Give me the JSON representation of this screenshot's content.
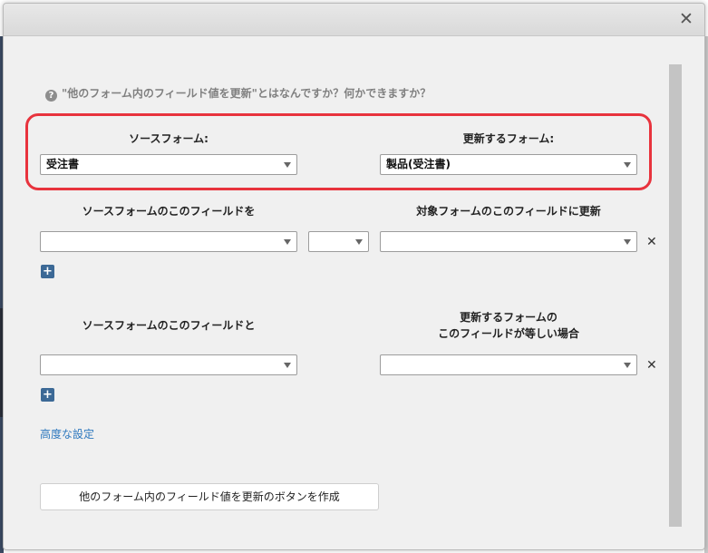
{
  "dialog": {
    "close_icon": "close-icon"
  },
  "help": {
    "icon": "question-circle-icon",
    "text": "\"他のフォーム内のフィールド値を更新\"とはなんですか？何かできますか？"
  },
  "forms": {
    "source_label": "ソースフォーム:",
    "source_value": "受注書",
    "target_label": "更新するフォーム:",
    "target_value": "製品(受注書)"
  },
  "update_section": {
    "source_field_label": "ソースフォームのこのフィールドを",
    "target_field_label": "対象フォームのこのフィールドに更新",
    "source_field_value": "",
    "operator_value": "",
    "target_field_value": "",
    "remove_icon": "✕",
    "add_icon": "+"
  },
  "match_section": {
    "source_field_label": "ソースフォームのこのフィールドと",
    "target_field_label_line1": "更新するフォームの",
    "target_field_label_line2": "このフィールドが等しい場合",
    "source_field_value": "",
    "target_field_value": "",
    "remove_icon": "✕",
    "add_icon": "+"
  },
  "advanced_link": "高度な設定",
  "create_button": "他のフォーム内のフィールド値を更新のボタンを作成",
  "colors": {
    "highlight": "#e8333d",
    "link": "#2d78be",
    "add_button": "#3c6996"
  }
}
